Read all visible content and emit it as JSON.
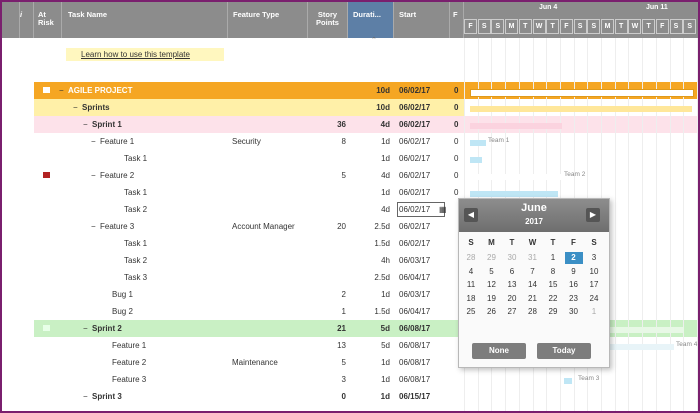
{
  "headers": {
    "at_risk": "At Risk",
    "task_name": "Task Name",
    "feature_type": "Feature Type",
    "story_points": "Story Points",
    "duration": "Durati...",
    "start": "Start",
    "finish": "F"
  },
  "gantt_header": {
    "week1": "Jun 4",
    "week2": "Jun 11",
    "days": [
      "F",
      "S",
      "S",
      "M",
      "T",
      "W",
      "T",
      "F",
      "S",
      "S",
      "M",
      "T",
      "W",
      "T",
      "F",
      "S",
      "S"
    ]
  },
  "learn_link": "Learn how to use this template",
  "rows": [
    {
      "name": "AGILE PROJECT",
      "feature": "",
      "points": "",
      "duration": "10d",
      "start": "06/02/17",
      "finish": "0"
    },
    {
      "name": "Sprints",
      "feature": "",
      "points": "",
      "duration": "10d",
      "start": "06/02/17",
      "finish": "0"
    },
    {
      "name": "Sprint 1",
      "feature": "",
      "points": "36",
      "duration": "4d",
      "start": "06/02/17",
      "finish": "0"
    },
    {
      "name": "Feature 1",
      "feature": "Security",
      "points": "8",
      "duration": "1d",
      "start": "06/02/17",
      "finish": "0"
    },
    {
      "name": "Task 1",
      "feature": "",
      "points": "",
      "duration": "1d",
      "start": "06/02/17",
      "finish": "0"
    },
    {
      "name": "Feature 2",
      "feature": "",
      "points": "5",
      "duration": "4d",
      "start": "06/02/17",
      "finish": "0"
    },
    {
      "name": "Task 1",
      "feature": "",
      "points": "",
      "duration": "1d",
      "start": "06/02/17",
      "finish": "0"
    },
    {
      "name": "Task 2",
      "feature": "",
      "points": "",
      "duration": "4d",
      "start": "06/02/17",
      "finish": ""
    },
    {
      "name": "Feature 3",
      "feature": "Account Manager",
      "points": "20",
      "duration": "2.5d",
      "start": "06/02/17",
      "finish": ""
    },
    {
      "name": "Task 1",
      "feature": "",
      "points": "",
      "duration": "1.5d",
      "start": "06/02/17",
      "finish": ""
    },
    {
      "name": "Task 2",
      "feature": "",
      "points": "",
      "duration": "4h",
      "start": "06/03/17",
      "finish": ""
    },
    {
      "name": "Task 3",
      "feature": "",
      "points": "",
      "duration": "2.5d",
      "start": "06/04/17",
      "finish": ""
    },
    {
      "name": "Bug 1",
      "feature": "",
      "points": "2",
      "duration": "1d",
      "start": "06/03/17",
      "finish": ""
    },
    {
      "name": "Bug 2",
      "feature": "",
      "points": "1",
      "duration": "1.5d",
      "start": "06/04/17",
      "finish": ""
    },
    {
      "name": "Sprint 2",
      "feature": "",
      "points": "21",
      "duration": "5d",
      "start": "06/08/17",
      "finish": ""
    },
    {
      "name": "Feature 1",
      "feature": "",
      "points": "13",
      "duration": "5d",
      "start": "06/08/17",
      "finish": ""
    },
    {
      "name": "Feature 2",
      "feature": "Maintenance",
      "points": "5",
      "duration": "1d",
      "start": "06/08/17",
      "finish": ""
    },
    {
      "name": "Feature 3",
      "feature": "",
      "points": "3",
      "duration": "1d",
      "start": "06/08/17",
      "finish": ""
    },
    {
      "name": "Sprint 3",
      "feature": "",
      "points": "0",
      "duration": "1d",
      "start": "06/15/17",
      "finish": ""
    }
  ],
  "gantt_labels": {
    "team1": "Team 1",
    "team2": "Team 2",
    "team3": "Team 3",
    "team4": "Team 4"
  },
  "calendar": {
    "month": "June",
    "year": "2017",
    "prev": "◀",
    "next": "▶",
    "weekdays": [
      "S",
      "M",
      "T",
      "W",
      "T",
      "F",
      "S"
    ],
    "weeks": [
      [
        "28",
        "29",
        "30",
        "31",
        "1",
        "2",
        "3"
      ],
      [
        "4",
        "5",
        "6",
        "7",
        "8",
        "9",
        "10"
      ],
      [
        "11",
        "12",
        "13",
        "14",
        "15",
        "16",
        "17"
      ],
      [
        "18",
        "19",
        "20",
        "21",
        "22",
        "23",
        "24"
      ],
      [
        "25",
        "26",
        "27",
        "28",
        "29",
        "30",
        "1"
      ]
    ],
    "selected": "2",
    "none_label": "None",
    "today_label": "Today"
  },
  "colors": {
    "orange": "#f5a623",
    "yellow": "#fff3b8",
    "pink": "#fde3ea",
    "green": "#c9f0c4",
    "selected": "#3b8fc5",
    "flag": "#b22222"
  }
}
